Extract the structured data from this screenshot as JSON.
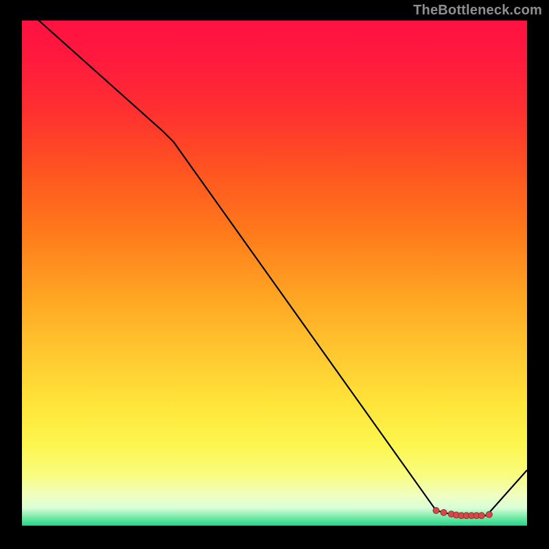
{
  "watermark": "TheBottleneck.com",
  "chart_data": {
    "type": "line",
    "title": "",
    "xlabel": "",
    "ylabel": "",
    "xlim": [
      0,
      100
    ],
    "ylim": [
      0,
      100
    ],
    "x": [
      0,
      28,
      30,
      82,
      86,
      88,
      90,
      92,
      100
    ],
    "values": [
      103,
      78,
      76,
      3,
      2,
      2,
      2,
      2,
      11
    ],
    "markers_x": [
      82,
      83.5,
      85,
      86,
      87,
      88,
      89,
      90,
      91,
      92.5
    ],
    "markers_y": [
      3,
      2.6,
      2.3,
      2.1,
      2,
      2,
      2,
      2,
      2,
      2.2
    ],
    "gradient_stops": [
      {
        "offset": 0.0,
        "color": "#ff1242"
      },
      {
        "offset": 0.08,
        "color": "#ff1a3d"
      },
      {
        "offset": 0.18,
        "color": "#ff3030"
      },
      {
        "offset": 0.3,
        "color": "#ff5520"
      },
      {
        "offset": 0.42,
        "color": "#ff7a1b"
      },
      {
        "offset": 0.54,
        "color": "#ffa322"
      },
      {
        "offset": 0.66,
        "color": "#ffc830"
      },
      {
        "offset": 0.76,
        "color": "#ffe53a"
      },
      {
        "offset": 0.84,
        "color": "#fcf64e"
      },
      {
        "offset": 0.9,
        "color": "#f9fc80"
      },
      {
        "offset": 0.94,
        "color": "#f0ffc0"
      },
      {
        "offset": 0.965,
        "color": "#d8ffd8"
      },
      {
        "offset": 0.985,
        "color": "#6fe8a4"
      },
      {
        "offset": 1.0,
        "color": "#1fd38a"
      }
    ],
    "line_color": "#000000",
    "marker_fill": "#d24a4a",
    "marker_stroke": "#9c2d2d"
  }
}
